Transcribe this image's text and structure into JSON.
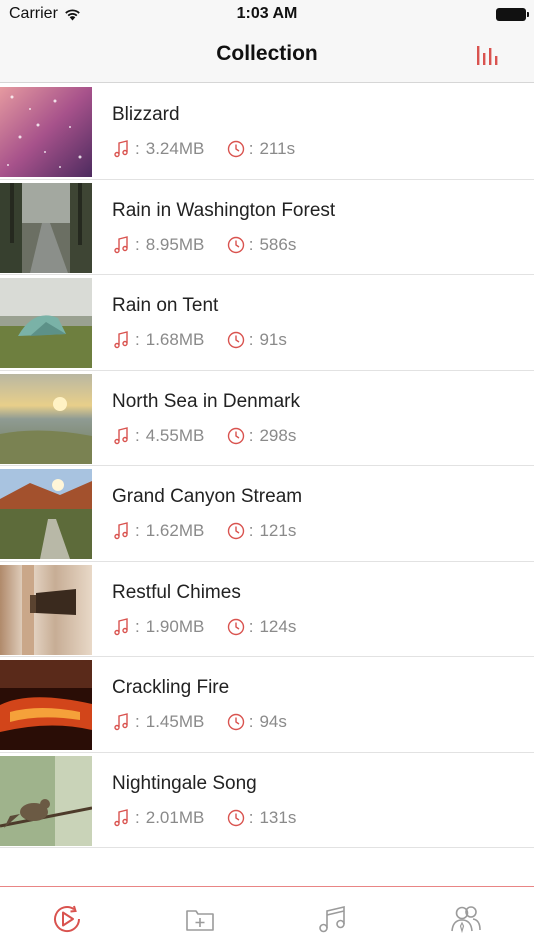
{
  "status": {
    "carrier": "Carrier",
    "time": "1:03 AM"
  },
  "nav": {
    "title": "Collection",
    "action_icon": "equalizer-icon"
  },
  "colors": {
    "accent": "#d9534f",
    "meta_text": "#8a8a8a",
    "title_text": "#222222",
    "tab_inactive": "#9b9b9b"
  },
  "items": [
    {
      "title": "Blizzard",
      "size": "3.24MB",
      "duration": "211s",
      "thumb": "snowfall-pink"
    },
    {
      "title": "Rain in Washington Forest",
      "size": "8.95MB",
      "duration": "586s",
      "thumb": "forest-path"
    },
    {
      "title": "Rain on Tent",
      "size": "1.68MB",
      "duration": "91s",
      "thumb": "tent-field"
    },
    {
      "title": "North Sea in Denmark",
      "size": "4.55MB",
      "duration": "298s",
      "thumb": "sea-sunset"
    },
    {
      "title": "Grand Canyon Stream",
      "size": "1.62MB",
      "duration": "121s",
      "thumb": "canyon-stream"
    },
    {
      "title": "Restful Chimes",
      "size": "1.90MB",
      "duration": "124s",
      "thumb": "chime"
    },
    {
      "title": "Crackling Fire",
      "size": "1.45MB",
      "duration": "94s",
      "thumb": "embers"
    },
    {
      "title": "Nightingale Song",
      "size": "2.01MB",
      "duration": "131s",
      "thumb": "bird-branch"
    }
  ],
  "tabs": [
    {
      "icon": "play-circle-icon",
      "active": true
    },
    {
      "icon": "add-folder-icon",
      "active": false
    },
    {
      "icon": "music-note-icon",
      "active": false
    },
    {
      "icon": "users-icon",
      "active": false
    }
  ]
}
